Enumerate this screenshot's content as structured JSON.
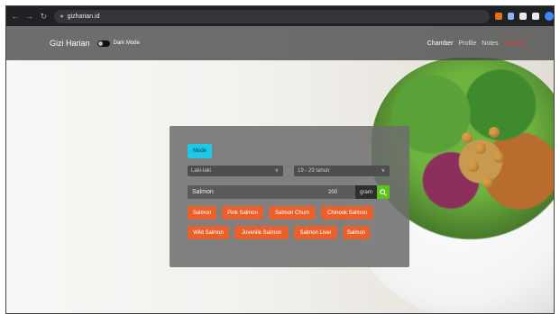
{
  "browser": {
    "url": "gizharian.id",
    "extension_colors": [
      "#e8710a",
      "#8ab4f8",
      "#e8eaed",
      "#e8eaed"
    ]
  },
  "navbar": {
    "brand": "Gizi Harian",
    "dark_mode_label": "Dark Mode",
    "links": [
      {
        "label": "Chamber"
      },
      {
        "label": "Profile"
      },
      {
        "label": "Notes"
      },
      {
        "label": "Logout"
      }
    ]
  },
  "panel": {
    "mode_label": "Mode",
    "gender_select": "Laki-laki",
    "age_select": "19 - 29 tahun",
    "food_input_value": "Salmon",
    "quantity_value": "200",
    "unit_label": "gram",
    "suggestions_row1": [
      "Salmon",
      "Pink Salmon",
      "Salmon Chum",
      "Chinook Salmon"
    ],
    "suggestions_row2": [
      "Wild Salmon",
      "Juvenile Salmon",
      "Salmon Liver",
      "Salmon"
    ]
  },
  "colors": {
    "mode_button": "#1fc8e6",
    "chip": "#e8612c",
    "search_button": "#5ec41a",
    "logout_link": "#e53935"
  }
}
